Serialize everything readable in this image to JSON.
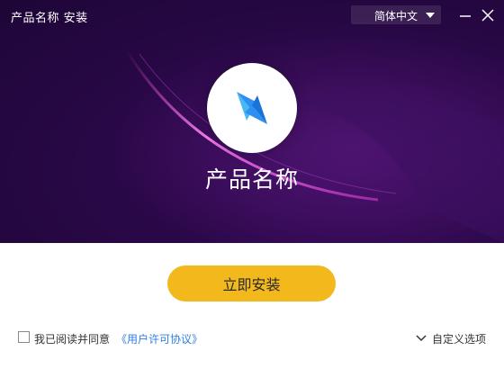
{
  "window": {
    "title": "产品名称 安装",
    "language": "简体中文"
  },
  "hero": {
    "product_name": "产品名称",
    "icon": "lightning-logo-icon"
  },
  "actions": {
    "install_label": "立即安装",
    "agree_text": "我已阅读并同意",
    "agreement_link": "《用户许可协议》",
    "agree_checked": false,
    "custom_label": "自定义选项"
  },
  "colors": {
    "hero_bg": "#2a0848",
    "accent_line": "#e23ad6",
    "install_button": "#f2b81c",
    "link": "#2f7de1",
    "logo_blue": "#2196f3"
  }
}
